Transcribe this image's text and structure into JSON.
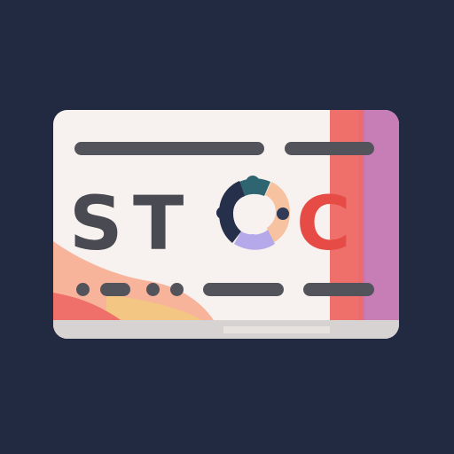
{
  "card": {
    "letters": [
      "S",
      "T",
      "C"
    ],
    "colors": {
      "background": "#212a41",
      "card_base": "#f7f2ef",
      "card_shadow": "#d7d3d2",
      "text_dark": "#4a4a52",
      "text_red": "#e64b45",
      "stripe_red": "#ef6f6a",
      "stripe_purple": "#c77eb7",
      "wave_orange": "#f7b49a",
      "wave_yellow": "#f3c683",
      "line_dark": "#53535b",
      "ring_teal": "#2f6570",
      "ring_navy": "#26304a",
      "ring_peach": "#f6c2a0",
      "ring_lavender": "#b5a9ea"
    }
  }
}
